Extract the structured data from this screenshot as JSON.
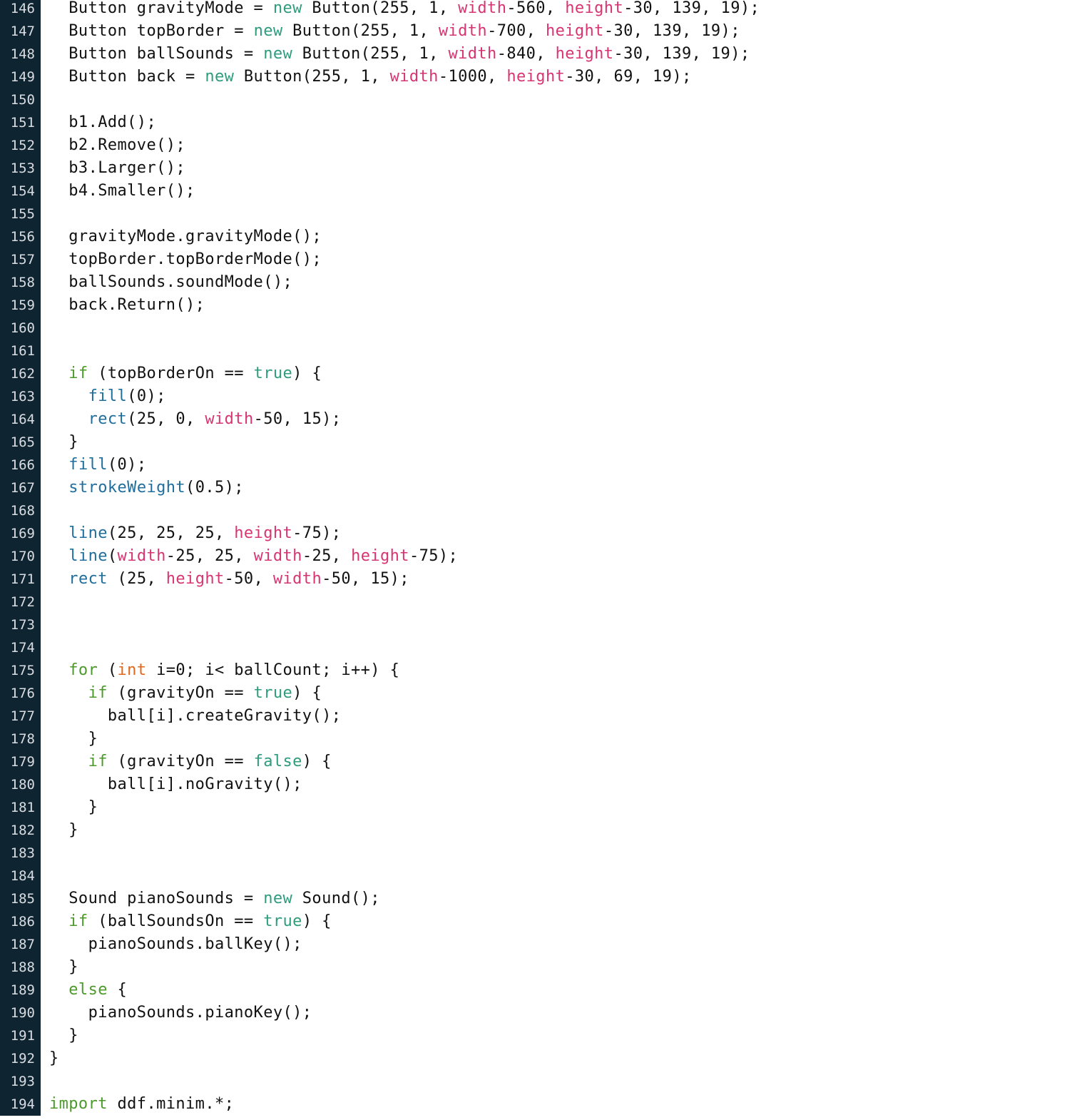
{
  "editor": {
    "line_numbers": [
      "146",
      "147",
      "148",
      "149",
      "150",
      "151",
      "152",
      "153",
      "154",
      "155",
      "156",
      "157",
      "158",
      "159",
      "160",
      "161",
      "162",
      "163",
      "164",
      "165",
      "166",
      "167",
      "168",
      "169",
      "170",
      "171",
      "172",
      "173",
      "174",
      "175",
      "176",
      "177",
      "178",
      "179",
      "180",
      "181",
      "182",
      "183",
      "184",
      "185",
      "186",
      "187",
      "188",
      "189",
      "190",
      "191",
      "192",
      "193",
      "194"
    ],
    "lines": [
      [
        [
          "",
          "  Button gravityMode = "
        ],
        [
          "nw",
          "new"
        ],
        [
          "",
          " Button(255, 1, "
        ],
        [
          "va",
          "width"
        ],
        [
          "",
          "-560, "
        ],
        [
          "va",
          "height"
        ],
        [
          "",
          "-30, 139, 19);"
        ]
      ],
      [
        [
          "",
          "  Button topBorder = "
        ],
        [
          "nw",
          "new"
        ],
        [
          "",
          " Button(255, 1, "
        ],
        [
          "va",
          "width"
        ],
        [
          "",
          "-700, "
        ],
        [
          "va",
          "height"
        ],
        [
          "",
          "-30, 139, 19);"
        ]
      ],
      [
        [
          "",
          "  Button ballSounds = "
        ],
        [
          "nw",
          "new"
        ],
        [
          "",
          " Button(255, 1, "
        ],
        [
          "va",
          "width"
        ],
        [
          "",
          "-840, "
        ],
        [
          "va",
          "height"
        ],
        [
          "",
          "-30, 139, 19);"
        ]
      ],
      [
        [
          "",
          "  Button back = "
        ],
        [
          "nw",
          "new"
        ],
        [
          "",
          " Button(255, 1, "
        ],
        [
          "va",
          "width"
        ],
        [
          "",
          "-1000, "
        ],
        [
          "va",
          "height"
        ],
        [
          "",
          "-30, 69, 19);"
        ]
      ],
      [],
      [
        [
          "",
          "  b1.Add();"
        ]
      ],
      [
        [
          "",
          "  b2.Remove();"
        ]
      ],
      [
        [
          "",
          "  b3.Larger();"
        ]
      ],
      [
        [
          "",
          "  b4.Smaller();"
        ]
      ],
      [],
      [
        [
          "",
          "  gravityMode.gravityMode();"
        ]
      ],
      [
        [
          "",
          "  topBorder.topBorderMode();"
        ]
      ],
      [
        [
          "",
          "  ballSounds.soundMode();"
        ]
      ],
      [
        [
          "",
          "  back.Return();"
        ]
      ],
      [],
      [],
      [
        [
          "kw",
          "  if"
        ],
        [
          "",
          " (topBorderOn == "
        ],
        [
          "nw",
          "true"
        ],
        [
          "",
          ") {"
        ]
      ],
      [
        [
          "",
          "    "
        ],
        [
          "fn",
          "fill"
        ],
        [
          "",
          "(0);"
        ]
      ],
      [
        [
          "",
          "    "
        ],
        [
          "fn",
          "rect"
        ],
        [
          "",
          "(25, 0, "
        ],
        [
          "va",
          "width"
        ],
        [
          "",
          "-50, 15);"
        ]
      ],
      [
        [
          "",
          "  }"
        ]
      ],
      [
        [
          "",
          "  "
        ],
        [
          "fn",
          "fill"
        ],
        [
          "",
          "(0);"
        ]
      ],
      [
        [
          "",
          "  "
        ],
        [
          "fn",
          "strokeWeight"
        ],
        [
          "",
          "(0.5);"
        ]
      ],
      [],
      [
        [
          "",
          "  "
        ],
        [
          "fn",
          "line"
        ],
        [
          "",
          "(25, 25, 25, "
        ],
        [
          "va",
          "height"
        ],
        [
          "",
          "-75);"
        ]
      ],
      [
        [
          "",
          "  "
        ],
        [
          "fn",
          "line"
        ],
        [
          "",
          "("
        ],
        [
          "va",
          "width"
        ],
        [
          "",
          "-25, 25, "
        ],
        [
          "va",
          "width"
        ],
        [
          "",
          "-25, "
        ],
        [
          "va",
          "height"
        ],
        [
          "",
          "-75);"
        ]
      ],
      [
        [
          "",
          "  "
        ],
        [
          "fn",
          "rect"
        ],
        [
          "",
          " (25, "
        ],
        [
          "va",
          "height"
        ],
        [
          "",
          "-50, "
        ],
        [
          "va",
          "width"
        ],
        [
          "",
          "-50, 15);"
        ]
      ],
      [],
      [],
      [],
      [
        [
          "kw",
          "  for"
        ],
        [
          "",
          " ("
        ],
        [
          "ty",
          "int"
        ],
        [
          "",
          " i=0; i< ballCount; i++) {"
        ]
      ],
      [
        [
          "kw",
          "    if"
        ],
        [
          "",
          " (gravityOn == "
        ],
        [
          "nw",
          "true"
        ],
        [
          "",
          ") {"
        ]
      ],
      [
        [
          "",
          "      ball[i].createGravity();"
        ]
      ],
      [
        [
          "",
          "    }"
        ]
      ],
      [
        [
          "kw",
          "    if"
        ],
        [
          "",
          " (gravityOn == "
        ],
        [
          "nw",
          "false"
        ],
        [
          "",
          ") {"
        ]
      ],
      [
        [
          "",
          "      ball[i].noGravity();"
        ]
      ],
      [
        [
          "",
          "    }"
        ]
      ],
      [
        [
          "",
          "  }"
        ]
      ],
      [],
      [],
      [
        [
          "",
          "  Sound pianoSounds = "
        ],
        [
          "nw",
          "new"
        ],
        [
          "",
          " Sound();"
        ]
      ],
      [
        [
          "kw",
          "  if"
        ],
        [
          "",
          " (ballSoundsOn == "
        ],
        [
          "nw",
          "true"
        ],
        [
          "",
          ") {"
        ]
      ],
      [
        [
          "",
          "    pianoSounds.ballKey();"
        ]
      ],
      [
        [
          "",
          "  }"
        ]
      ],
      [
        [
          "kw",
          "  else"
        ],
        [
          "",
          " {"
        ]
      ],
      [
        [
          "",
          "    pianoSounds.pianoKey();"
        ]
      ],
      [
        [
          "",
          "  }"
        ]
      ],
      [
        [
          "",
          "}"
        ]
      ],
      [],
      [
        [
          "kw",
          "import"
        ],
        [
          "",
          " ddf.minim.*;"
        ]
      ]
    ]
  },
  "colors": {
    "gutter_bg": "#0f2431",
    "keyword": "#4c9a2a",
    "literal": "#2d9c7d",
    "type": "#e2661c",
    "function": "#1f6e9c",
    "variable": "#d73572"
  }
}
